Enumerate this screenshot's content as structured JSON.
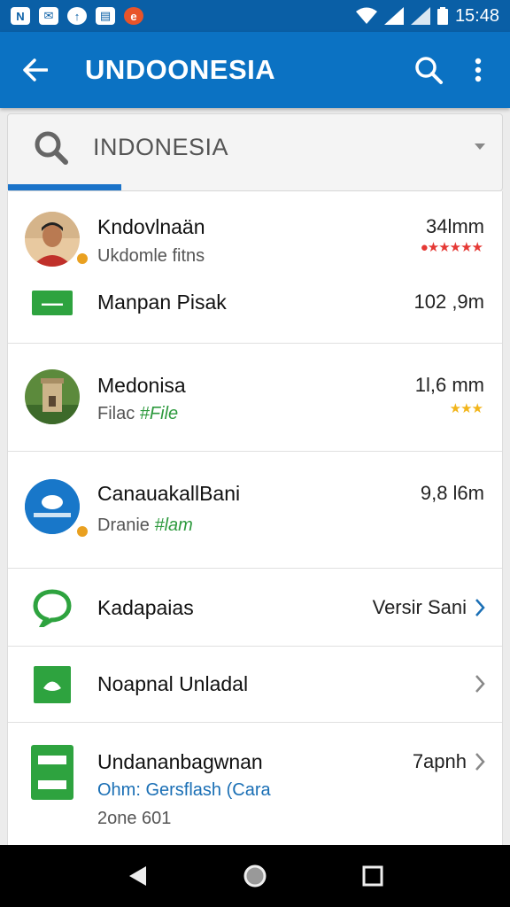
{
  "status_bar": {
    "icons": [
      "notification-icon-1",
      "notification-icon-2",
      "notification-icon-3",
      "notification-icon-4",
      "notification-icon-5"
    ],
    "time": "15:48"
  },
  "app_bar": {
    "title": "UNDOONESIA"
  },
  "search": {
    "value": "INDONESIA"
  },
  "list": [
    {
      "name": "Kndovlnaän",
      "sub": "Ukdomle fitns",
      "value": "34lmm",
      "stars": "●★★★★★"
    },
    {
      "name": "Manpan Pisak",
      "value": "102 ,9m"
    },
    {
      "name": "Medonisa",
      "sub_prefix": "Filac",
      "sub_green": "#File",
      "value": "1l,6 mm",
      "stars": "★★★"
    },
    {
      "name": "CanauakallBani",
      "sub_prefix": "Dranie",
      "sub_green": "#lam",
      "value": "9,8 l6m"
    },
    {
      "name": "Kadapaias",
      "link": "Versir Sani"
    },
    {
      "name": "Noapnal Unladal"
    },
    {
      "name": "Undananbagwnan",
      "sub_blue": "Ohm: Gersflash (Cara",
      "sub2": "2one 601",
      "link": "7apnh"
    }
  ],
  "colors": {
    "status_bar": "#0a5fa6",
    "app_bar": "#0b72c3",
    "accent_green": "#2ea33f",
    "link_blue": "#1a6fb5",
    "star_red": "#e53935",
    "star_gold": "#f2b51b"
  }
}
